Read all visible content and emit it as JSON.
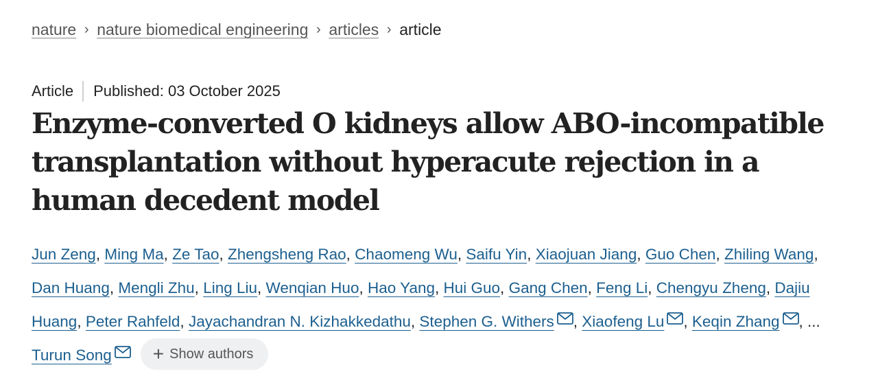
{
  "breadcrumb": {
    "items": [
      {
        "label": "nature"
      },
      {
        "label": "nature biomedical engineering"
      },
      {
        "label": "articles"
      }
    ],
    "current": "article",
    "separator": "›"
  },
  "meta": {
    "type": "Article",
    "published": "Published: 03 October 2025"
  },
  "title": "Enzyme-converted O kidneys allow ABO-incompatible transplantation without hyperacute rejection in a human decedent model",
  "authors": {
    "list": [
      {
        "name": "Jun Zeng",
        "corresponding": false
      },
      {
        "name": "Ming Ma",
        "corresponding": false
      },
      {
        "name": "Ze Tao",
        "corresponding": false
      },
      {
        "name": "Zhengsheng Rao",
        "corresponding": false
      },
      {
        "name": "Chaomeng Wu",
        "corresponding": false
      },
      {
        "name": "Saifu Yin",
        "corresponding": false
      },
      {
        "name": "Xiaojuan Jiang",
        "corresponding": false
      },
      {
        "name": "Guo Chen",
        "corresponding": false
      },
      {
        "name": "Zhiling Wang",
        "corresponding": false
      },
      {
        "name": "Dan Huang",
        "corresponding": false
      },
      {
        "name": "Mengli Zhu",
        "corresponding": false
      },
      {
        "name": "Ling Liu",
        "corresponding": false
      },
      {
        "name": "Wenqian Huo",
        "corresponding": false
      },
      {
        "name": "Hao Yang",
        "corresponding": false
      },
      {
        "name": "Hui Guo",
        "corresponding": false
      },
      {
        "name": "Gang Chen",
        "corresponding": false
      },
      {
        "name": "Feng Li",
        "corresponding": false
      },
      {
        "name": "Chengyu Zheng",
        "corresponding": false
      },
      {
        "name": "Dajiu Huang",
        "corresponding": false
      },
      {
        "name": "Peter Rahfeld",
        "corresponding": false
      },
      {
        "name": "Jayachandran N. Kizhakkedathu",
        "corresponding": false
      },
      {
        "name": "Stephen G. Withers",
        "corresponding": true
      },
      {
        "name": "Xiaofeng Lu",
        "corresponding": true
      },
      {
        "name": "Keqin Zhang",
        "corresponding": true
      }
    ],
    "ellipsis": "...",
    "last": {
      "name": "Turun Song",
      "corresponding": true
    },
    "show_authors_label": "Show authors",
    "mail_icon": "mail-icon",
    "plus_icon": "plus-icon"
  },
  "colors": {
    "link": "#1c5f8f",
    "text": "#222222",
    "muted": "#555555",
    "button_bg": "#eef0f2"
  }
}
